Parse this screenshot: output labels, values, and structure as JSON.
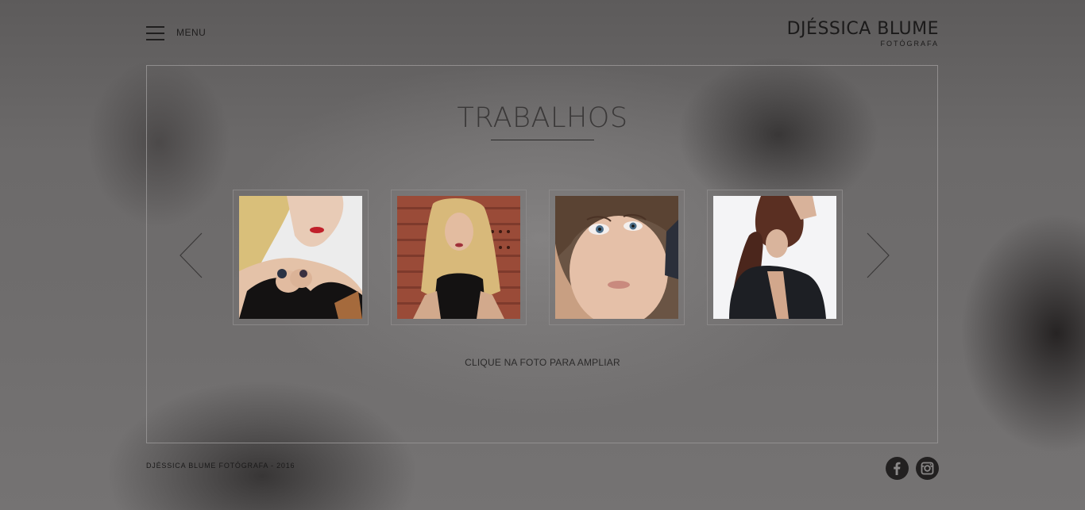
{
  "header": {
    "menu_label": "MENU",
    "logo_name": "DJÉSSICA BLUME",
    "logo_subtitle": "FOTÓGRAFA"
  },
  "main": {
    "title": "TRABALHOS",
    "hint": "CLIQUE NA FOTO PARA AMPLIAR",
    "gallery": [
      {
        "subject": "blonde woman with red lipstick and rings"
      },
      {
        "subject": "blonde woman against brick wall"
      },
      {
        "subject": "close-up portrait with earring"
      },
      {
        "subject": "woman in black shirt on white background"
      }
    ]
  },
  "footer": {
    "copyright": "DJÉSSICA BLUME FOTÓGRAFA - 2016",
    "social": [
      "facebook-icon",
      "instagram-icon"
    ]
  },
  "colors": {
    "background": "#6c6a6a",
    "text_dark": "#1f1e1e",
    "frame_border": "#969494"
  }
}
